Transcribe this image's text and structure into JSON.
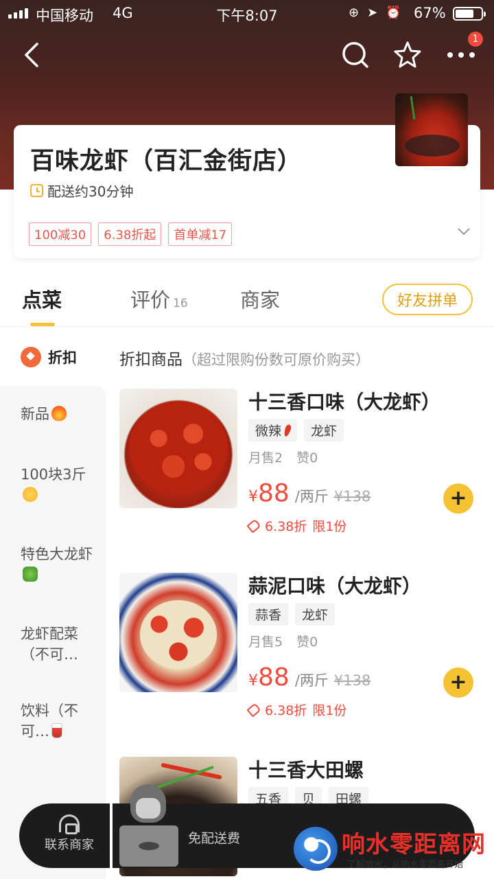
{
  "status_bar": {
    "carrier": "中国移动",
    "network": "4G",
    "time": "下午8:07",
    "battery": "67%"
  },
  "topbar": {
    "back_icon": "chevron-left-icon",
    "search_icon": "search-icon",
    "favorite_icon": "star-icon",
    "more_icon": "more-icon",
    "notification_count": "1"
  },
  "store": {
    "name": "百味龙虾（百汇金街店）",
    "delivery_time": "配送约30分钟",
    "promotions": [
      "100减30",
      "6.38折起",
      "首单减17"
    ]
  },
  "tabs": {
    "menu": "点菜",
    "reviews": "评价",
    "reviews_count": "16",
    "merchant": "商家",
    "group_order": "好友拼单"
  },
  "sidebar": {
    "active": "折扣",
    "items": [
      {
        "label": "新品"
      },
      {
        "label": "100块3斤"
      },
      {
        "label": "特色大龙虾"
      },
      {
        "label": "龙虾配菜（不可…"
      },
      {
        "label": "饮料（不可…"
      }
    ]
  },
  "section": {
    "title": "折扣商品",
    "note": "（超过限购份数可原价购买）"
  },
  "products": [
    {
      "name": "十三香口味（大龙虾）",
      "tags": [
        "微辣",
        "龙虾"
      ],
      "sales": "月售2",
      "likes": "赞0",
      "currency": "¥",
      "price": "88",
      "unit": "/两斤",
      "original_price": "¥138",
      "discount": "6.38折",
      "limit": "限1份"
    },
    {
      "name": "蒜泥口味（大龙虾）",
      "tags": [
        "蒜香",
        "龙虾"
      ],
      "sales": "月售5",
      "likes": "赞0",
      "currency": "¥",
      "price": "88",
      "unit": "/两斤",
      "original_price": "¥138",
      "discount": "6.38折",
      "limit": "限1份"
    },
    {
      "name": "十三香大田螺",
      "tags": [
        "五香",
        "贝",
        "田螺"
      ]
    }
  ],
  "cart": {
    "contact": "联系商家",
    "free_delivery": "免配送费"
  },
  "watermark": {
    "title": "响水零距离网",
    "subtitle": "了解响水，从响水零距离开始"
  },
  "colors": {
    "accent": "#f5c234",
    "price": "#f04b3d",
    "header_bg": "#6b2a22"
  }
}
